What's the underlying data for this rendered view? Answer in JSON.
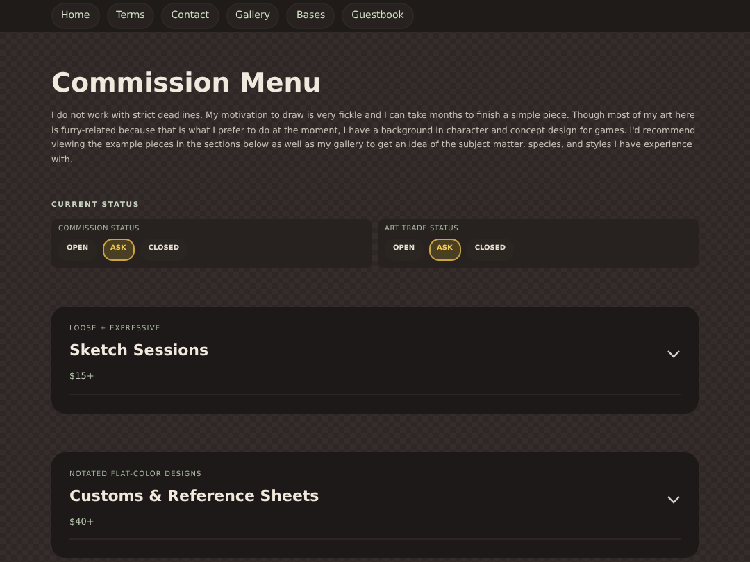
{
  "nav": [
    {
      "label": "Home"
    },
    {
      "label": "Terms"
    },
    {
      "label": "Contact"
    },
    {
      "label": "Gallery"
    },
    {
      "label": "Bases"
    },
    {
      "label": "Guestbook"
    }
  ],
  "title": "Commission Menu",
  "intro": "I do not work with strict deadlines. My motivation to draw is very fickle and I can take months to finish a simple piece. Though most of my art here is furry-related because that is what I prefer to do at the moment, I have a background in character and concept design for games. I'd recommend viewing the example pieces in the sections below as well as my gallery to get an idea of the subject matter, species, and styles I have experience with.",
  "status_heading": "CURRENT STATUS",
  "statuses": [
    {
      "label": "COMMISSION STATUS",
      "options": [
        {
          "label": "OPEN",
          "selected": false
        },
        {
          "label": "ASK",
          "selected": true
        },
        {
          "label": "CLOSED",
          "selected": false
        }
      ]
    },
    {
      "label": "ART TRADE STATUS",
      "options": [
        {
          "label": "OPEN",
          "selected": false
        },
        {
          "label": "ASK",
          "selected": true
        },
        {
          "label": "CLOSED",
          "selected": false
        }
      ]
    }
  ],
  "sections": [
    {
      "eyebrow": "LOOSE + EXPRESSIVE",
      "title": "Sketch Sessions",
      "price": "$15+",
      "expanded": false
    },
    {
      "eyebrow": "NOTATED FLAT-COLOR DESIGNS",
      "title": "Customs & Reference Sheets",
      "price": "$40+",
      "expanded": false
    }
  ]
}
